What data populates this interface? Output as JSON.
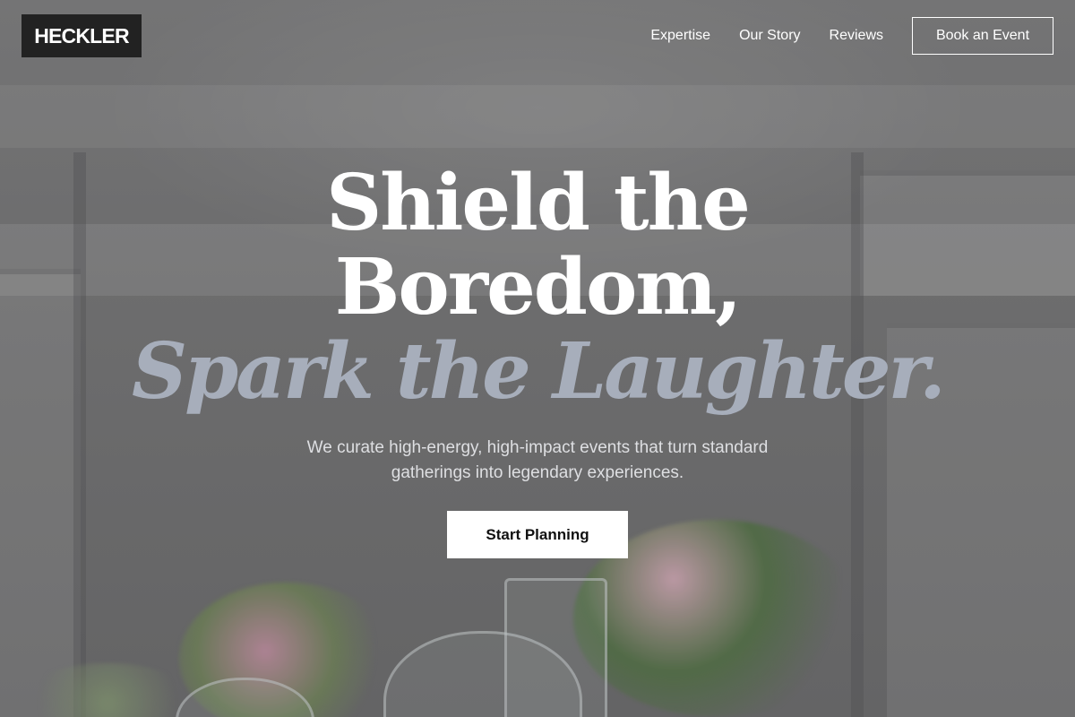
{
  "brand": {
    "logo_text": "HECKLER"
  },
  "nav": {
    "links": [
      {
        "label": "Expertise"
      },
      {
        "label": "Our Story"
      },
      {
        "label": "Reviews"
      }
    ],
    "cta_label": "Book an Event"
  },
  "hero": {
    "headline_line1": "Shield the",
    "headline_line2": "Boredom,",
    "headline_accent": "Spark the Laughter.",
    "subtitle_line1": "We curate high-energy, high-impact events that turn standard",
    "subtitle_line2": "gatherings into legendary experiences.",
    "cta_label": "Start Planning"
  },
  "colors": {
    "accent_text": "#a7aebb",
    "logo_bg": "#222222",
    "cta_bg": "#ffffff"
  }
}
